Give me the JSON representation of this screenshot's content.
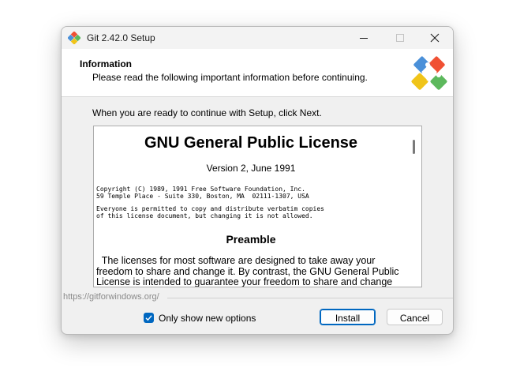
{
  "window": {
    "title": "Git 2.42.0 Setup"
  },
  "header": {
    "title": "Information",
    "subtitle": "Please read the following important information before continuing."
  },
  "intro": "When you are ready to continue with Setup, click Next.",
  "license": {
    "title": "GNU General Public License",
    "version": "Version 2, June 1991",
    "copyright_lines": [
      "Copyright (C) 1989, 1991 Free Software Foundation, Inc.",
      "59 Temple Place - Suite 330, Boston, MA  02111-1307, USA"
    ],
    "everyone_lines": [
      "Everyone is permitted to copy and distribute verbatim copies",
      "of this license document, but changing it is not allowed."
    ],
    "preamble_heading": "Preamble",
    "preamble_lines": [
      "  The licenses for most software are designed to take away your",
      "freedom to share and change it. By contrast, the GNU General Public",
      "License is intended to guarantee your freedom to share and change"
    ]
  },
  "footer": {
    "url": "https://gitforwindows.org/",
    "checkbox_label": "Only show new options",
    "checkbox_checked": true,
    "install_label": "Install",
    "cancel_label": "Cancel"
  },
  "colors": {
    "accent": "#0067c0",
    "git_orange": "#f05033",
    "logo_green": "#5cb85c",
    "logo_blue": "#4a90d9",
    "logo_yellow": "#f0c419"
  }
}
